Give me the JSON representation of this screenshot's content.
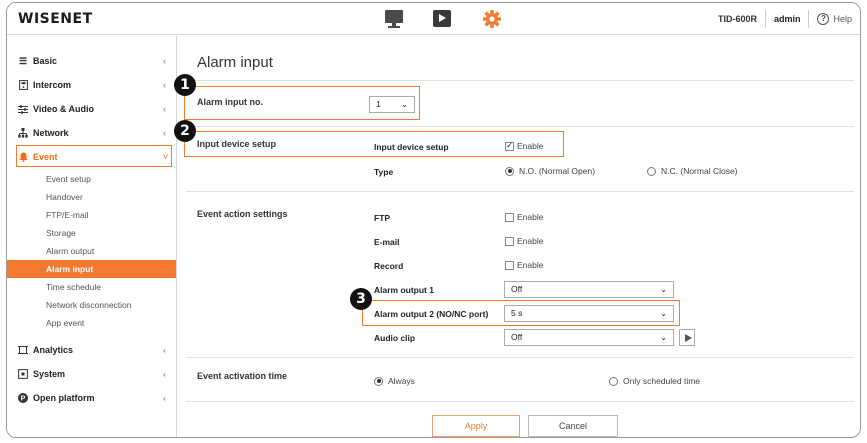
{
  "app": {
    "logo": "WISENET",
    "model": "TID-600R",
    "user": "admin",
    "help": "Help"
  },
  "topnav": {
    "icons": [
      "monitor-icon",
      "play-icon",
      "gear-icon"
    ],
    "accent": "#f47a30"
  },
  "sidebar": {
    "items": [
      {
        "label": "Basic",
        "icon": "menu-icon"
      },
      {
        "label": "Intercom",
        "icon": "intercom-icon"
      },
      {
        "label": "Video & Audio",
        "icon": "sliders-icon"
      },
      {
        "label": "Network",
        "icon": "network-icon"
      },
      {
        "label": "Event",
        "icon": "bell-icon"
      },
      {
        "label": "Analytics",
        "icon": "analytics-icon"
      },
      {
        "label": "System",
        "icon": "system-icon"
      },
      {
        "label": "Open platform",
        "icon": "platform-icon"
      }
    ],
    "event_sub": [
      "Event setup",
      "Handover",
      "FTP/E-mail",
      "Storage",
      "Alarm output",
      "Alarm input",
      "Time schedule",
      "Network disconnection",
      "App event"
    ],
    "active_sub": "Alarm input"
  },
  "main": {
    "title": "Alarm input",
    "alarm_input_no": {
      "label": "Alarm input no.",
      "value": "1"
    },
    "input_device": {
      "section": "Input device setup",
      "setup_label": "Input device setup",
      "setup_enable": "Enable",
      "type_label": "Type",
      "type_no": "N.O. (Normal Open)",
      "type_nc": "N.C. (Normal Close)"
    },
    "event_action": {
      "section": "Event action settings",
      "ftp_label": "FTP",
      "ftp_enable": "Enable",
      "email_label": "E-mail",
      "email_enable": "Enable",
      "record_label": "Record",
      "record_enable": "Enable",
      "alarm_out1_label": "Alarm output 1",
      "alarm_out1_value": "Off",
      "alarm_out2_label": "Alarm output 2 (NO/NC port)",
      "alarm_out2_value": "5 s",
      "audio_label": "Audio clip",
      "audio_value": "Off"
    },
    "activation": {
      "section": "Event activation time",
      "always": "Always",
      "scheduled": "Only scheduled time"
    },
    "buttons": {
      "apply": "Apply",
      "cancel": "Cancel"
    },
    "badges": [
      "1",
      "2",
      "3"
    ]
  }
}
